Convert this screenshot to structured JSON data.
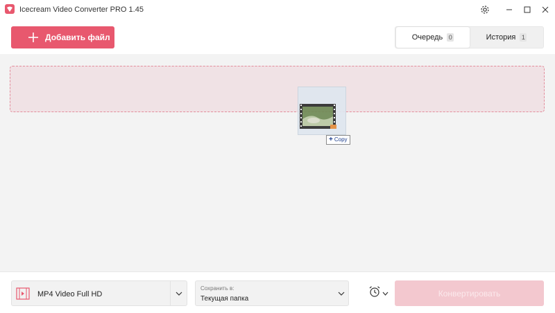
{
  "window": {
    "title": "Icecream Video Converter PRO 1.45"
  },
  "toolbar": {
    "add_file_label": "Добавить файл",
    "tabs": [
      {
        "label": "Очередь",
        "count": "0"
      },
      {
        "label": "История",
        "count": "1"
      }
    ]
  },
  "drag": {
    "copy_label": "Copy"
  },
  "bottom": {
    "format_value": "MP4 Video Full HD",
    "save_caption": "Сохранить в:",
    "save_value": "Текущая папка",
    "convert_label": "Конвертировать"
  },
  "colors": {
    "accent": "#e8586e",
    "dropzone_bg": "#f0e2e5",
    "convert_disabled": "#f3c8cf"
  },
  "icons": [
    "app-logo-icon",
    "gear-icon",
    "minimize-icon",
    "maximize-icon",
    "close-icon",
    "plus-icon",
    "film-icon",
    "chevron-down-icon",
    "alarm-clock-icon"
  ]
}
